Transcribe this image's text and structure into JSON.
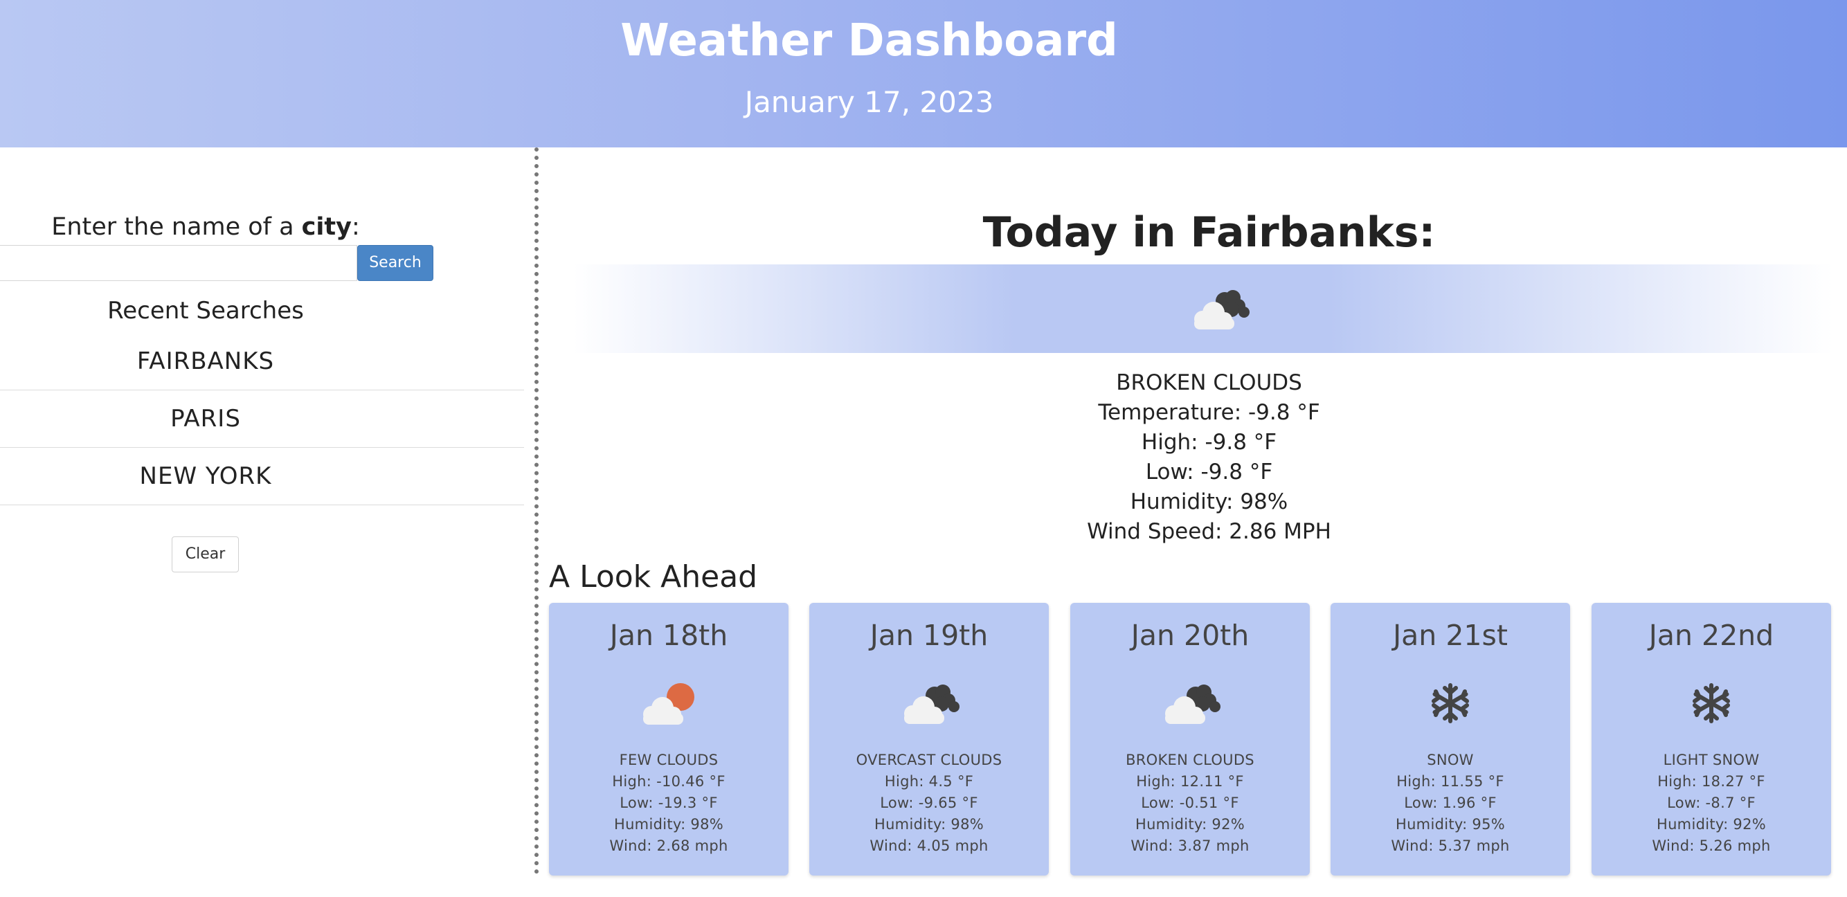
{
  "header": {
    "title": "Weather Dashboard",
    "date": "January 17, 2023"
  },
  "sidebar": {
    "prompt_prefix": "Enter the name of a ",
    "prompt_bold": "city",
    "prompt_suffix": ":",
    "search_value": "",
    "search_button": "Search",
    "recent_title": "Recent Searches",
    "recent": [
      "FAIRBANKS",
      "PARIS",
      "NEW YORK"
    ],
    "clear_button": "Clear"
  },
  "today": {
    "title": "Today in Fairbanks:",
    "icon": "broken-clouds-icon",
    "condition": "BROKEN CLOUDS",
    "temperature": "Temperature: -9.8 °F",
    "high": "High: -9.8 °F",
    "low": "Low: -9.8 °F",
    "humidity": "Humidity: 98%",
    "wind": "Wind Speed: 2.86 MPH"
  },
  "forecast": {
    "title": "A Look Ahead",
    "days": [
      {
        "date": "Jan 18th",
        "icon": "few-clouds-icon",
        "condition": "FEW CLOUDS",
        "high": "High: -10.46 °F",
        "low": "Low: -19.3 °F",
        "humidity": "Humidity: 98%",
        "wind": "Wind: 2.68 mph"
      },
      {
        "date": "Jan 19th",
        "icon": "overcast-clouds-icon",
        "condition": "OVERCAST CLOUDS",
        "high": "High: 4.5 °F",
        "low": "Low: -9.65 °F",
        "humidity": "Humidity: 98%",
        "wind": "Wind: 4.05 mph"
      },
      {
        "date": "Jan 20th",
        "icon": "broken-clouds-icon",
        "condition": "BROKEN CLOUDS",
        "high": "High: 12.11 °F",
        "low": "Low: -0.51 °F",
        "humidity": "Humidity: 92%",
        "wind": "Wind: 3.87 mph"
      },
      {
        "date": "Jan 21st",
        "icon": "snow-icon",
        "condition": "SNOW",
        "high": "High: 11.55 °F",
        "low": "Low: 1.96 °F",
        "humidity": "Humidity: 95%",
        "wind": "Wind: 5.37 mph"
      },
      {
        "date": "Jan 22nd",
        "icon": "snowflake-icon",
        "condition": "LIGHT SNOW",
        "high": "High: 18.27 °F",
        "low": "Low: -8.7 °F",
        "humidity": "Humidity: 92%",
        "wind": "Wind: 5.26 mph"
      }
    ]
  },
  "colors": {
    "header_start": "#b9c8f3",
    "header_end": "#7a97ec",
    "card_bg": "#b9c9f3",
    "search_button": "#4a86c7"
  }
}
